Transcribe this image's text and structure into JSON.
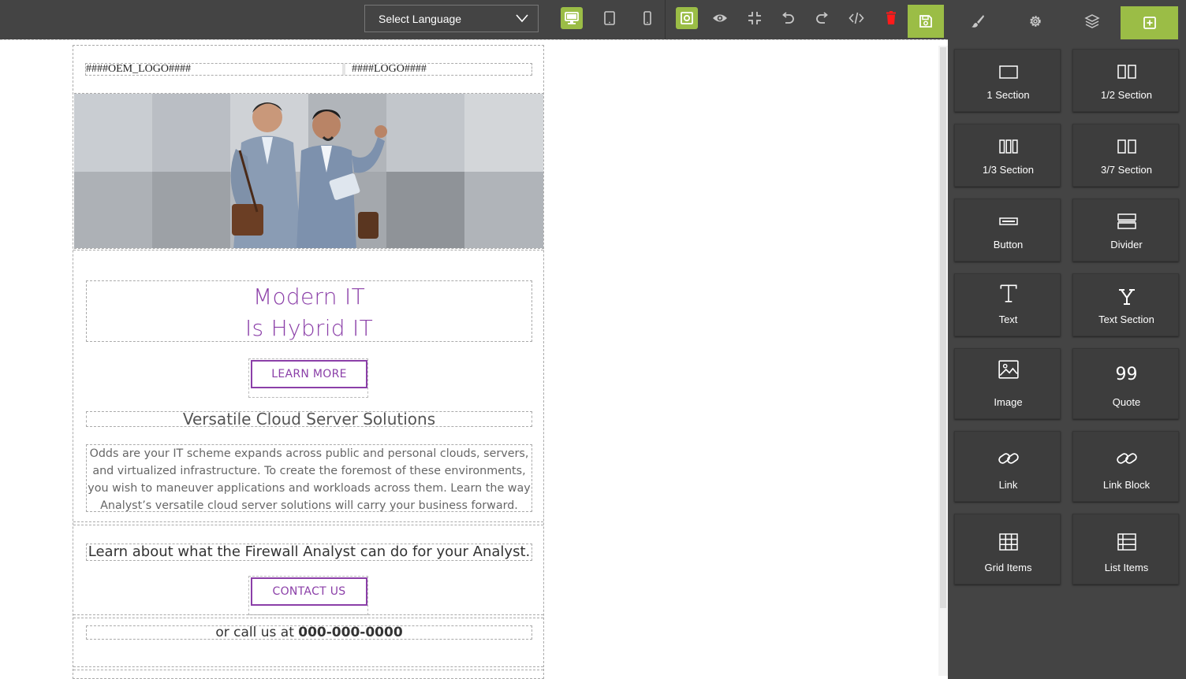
{
  "toolbar": {
    "language_select": "Select Language",
    "tools": [
      "desktop-view",
      "tablet-view",
      "mobile-view",
      "outline-view",
      "preview",
      "fullscreen",
      "undo",
      "redo",
      "code",
      "delete",
      "save"
    ],
    "panel_tabs": [
      "style-manager",
      "settings",
      "layer-manager",
      "blocks"
    ],
    "accent_color": "#9bbd46",
    "delete_color": "#ff1a1a"
  },
  "email": {
    "oem_logo": "####OEM_LOGO####",
    "logo": "####LOGO####",
    "headline_line1": "Modern IT",
    "headline_line2": "Is Hybrid IT",
    "learn_more_button": "LEARN MORE",
    "subheading": "Versatile Cloud Server Solutions",
    "body": "Odds are your IT scheme expands across public and personal clouds, servers, and virtualized infrastructure. To create the foremost of these environments, you wish to maneuver applications and workloads across them. Learn the way Analyst’s versatile cloud server solutions will carry your business forward.",
    "learn_about": "Learn about what the Firewall Analyst can do for your Analyst.",
    "contact_button": "CONTACT US",
    "call_prefix": "or call us at ",
    "phone": "000-000-0000",
    "brand_color": "#8b3fa8"
  },
  "blocks": [
    {
      "label": "1 Section",
      "icon": "one-section-icon"
    },
    {
      "label": "1/2 Section",
      "icon": "half-section-icon"
    },
    {
      "label": "1/3 Section",
      "icon": "third-section-icon"
    },
    {
      "label": "3/7 Section",
      "icon": "three-seven-section-icon"
    },
    {
      "label": "Button",
      "icon": "button-icon"
    },
    {
      "label": "Divider",
      "icon": "divider-icon"
    },
    {
      "label": "Text",
      "icon": "text-icon"
    },
    {
      "label": "Text Section",
      "icon": "text-section-icon"
    },
    {
      "label": "Image",
      "icon": "image-icon"
    },
    {
      "label": "Quote",
      "icon": "quote-icon"
    },
    {
      "label": "Link",
      "icon": "link-icon"
    },
    {
      "label": "Link Block",
      "icon": "link-block-icon"
    },
    {
      "label": "Grid Items",
      "icon": "grid-items-icon"
    },
    {
      "label": "List Items",
      "icon": "list-items-icon"
    }
  ]
}
